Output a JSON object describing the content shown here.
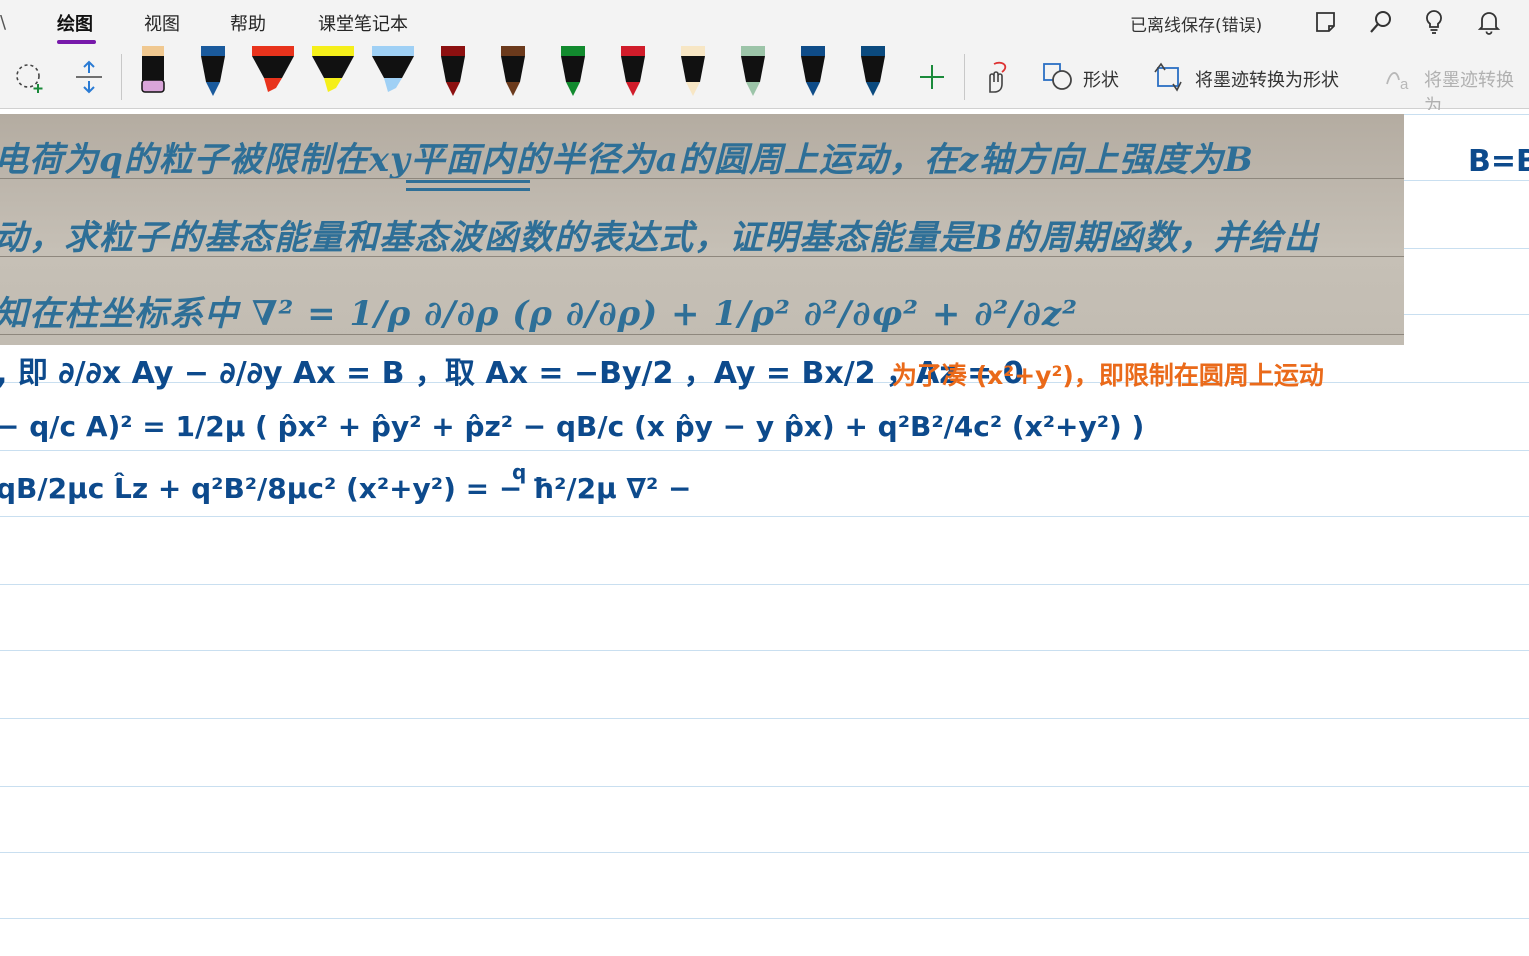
{
  "menu": {
    "tabs": [
      "绘图",
      "视图",
      "帮助",
      "课堂笔记本"
    ],
    "status": "已离线保存(错误)"
  },
  "toolbar": {
    "pens": [
      {
        "body": "#111111",
        "cap": "#f0c890",
        "tip": "#d9a5d9"
      },
      {
        "body": "#111111",
        "cap": "#1a5a9c",
        "tip": "#1a5a9c"
      },
      {
        "body": "#111111",
        "cap": "#e8331c",
        "tip": "#e8331c"
      },
      {
        "body": "#111111",
        "cap": "#f5ef1a",
        "tip": "#f5ef1a"
      },
      {
        "body": "#111111",
        "cap": "#9fd0f5",
        "tip": "#9fd0f5"
      },
      {
        "body": "#111111",
        "cap": "#8c1010",
        "tip": "#8c1010"
      },
      {
        "body": "#111111",
        "cap": "#6b3a1c",
        "tip": "#6b3a1c"
      },
      {
        "body": "#111111",
        "cap": "#128a2e",
        "tip": "#128a2e"
      },
      {
        "body": "#111111",
        "cap": "#d01c2a",
        "tip": "#d01c2a"
      },
      {
        "body": "#111111",
        "cap": "#f7e6c4",
        "tip": "#f7e6c4"
      },
      {
        "body": "#111111",
        "cap": "#9cc4a8",
        "tip": "#9cc4a8"
      },
      {
        "body": "#111111",
        "cap": "#0f4c88",
        "tip": "#0f4c88"
      },
      {
        "body": "#111111",
        "cap": "#0b4a7e",
        "tip": "#0b4a7e"
      }
    ],
    "shapes_label": "形状",
    "ink_to_shape_label": "将墨迹转换为形状",
    "ink_to_text_label": "将墨迹转换为"
  },
  "page": {
    "photo_lines": [
      "电荷为q的粒子被限制在xy平面内的半径为a的圆周上运动，在z轴方向上强度为B",
      "动，求粒子的基态能量和基态波函数的表达式，证明基态能量是B的周期函数，并给出",
      "知在柱坐标系中 ∇² = 1/ρ ∂/∂ρ (ρ ∂/∂ρ) + 1/ρ² ∂²/∂φ² + ∂²/∂z²"
    ],
    "right_margin_note": "B=B",
    "ink_line_1": ", 即 ∂/∂x Ay − ∂/∂y Ax = B ，取 Ax = −By/2 ，Ay = Bx/2 ，Az = 0",
    "orange_note": "为了凑 (x²+y²)，即限制在圆周上运动",
    "ink_line_2": "− q/c A)² = 1/2μ ( p̂x² + p̂y² + p̂z² − qB/c (x p̂y − y p̂x) + q²B²/4c² (x²+y²) )",
    "ink_line_3": "qB/2μc L̂z + q²B²/8μc² (x²+y²) = − ħ²/2μ ∇² −",
    "ink_line_3_tail": "q"
  },
  "colors": {
    "accent": "#7719aa",
    "ink_blue": "#0d4a8c",
    "ink_orange": "#ea6a1a",
    "rule": "#c9dff0"
  }
}
